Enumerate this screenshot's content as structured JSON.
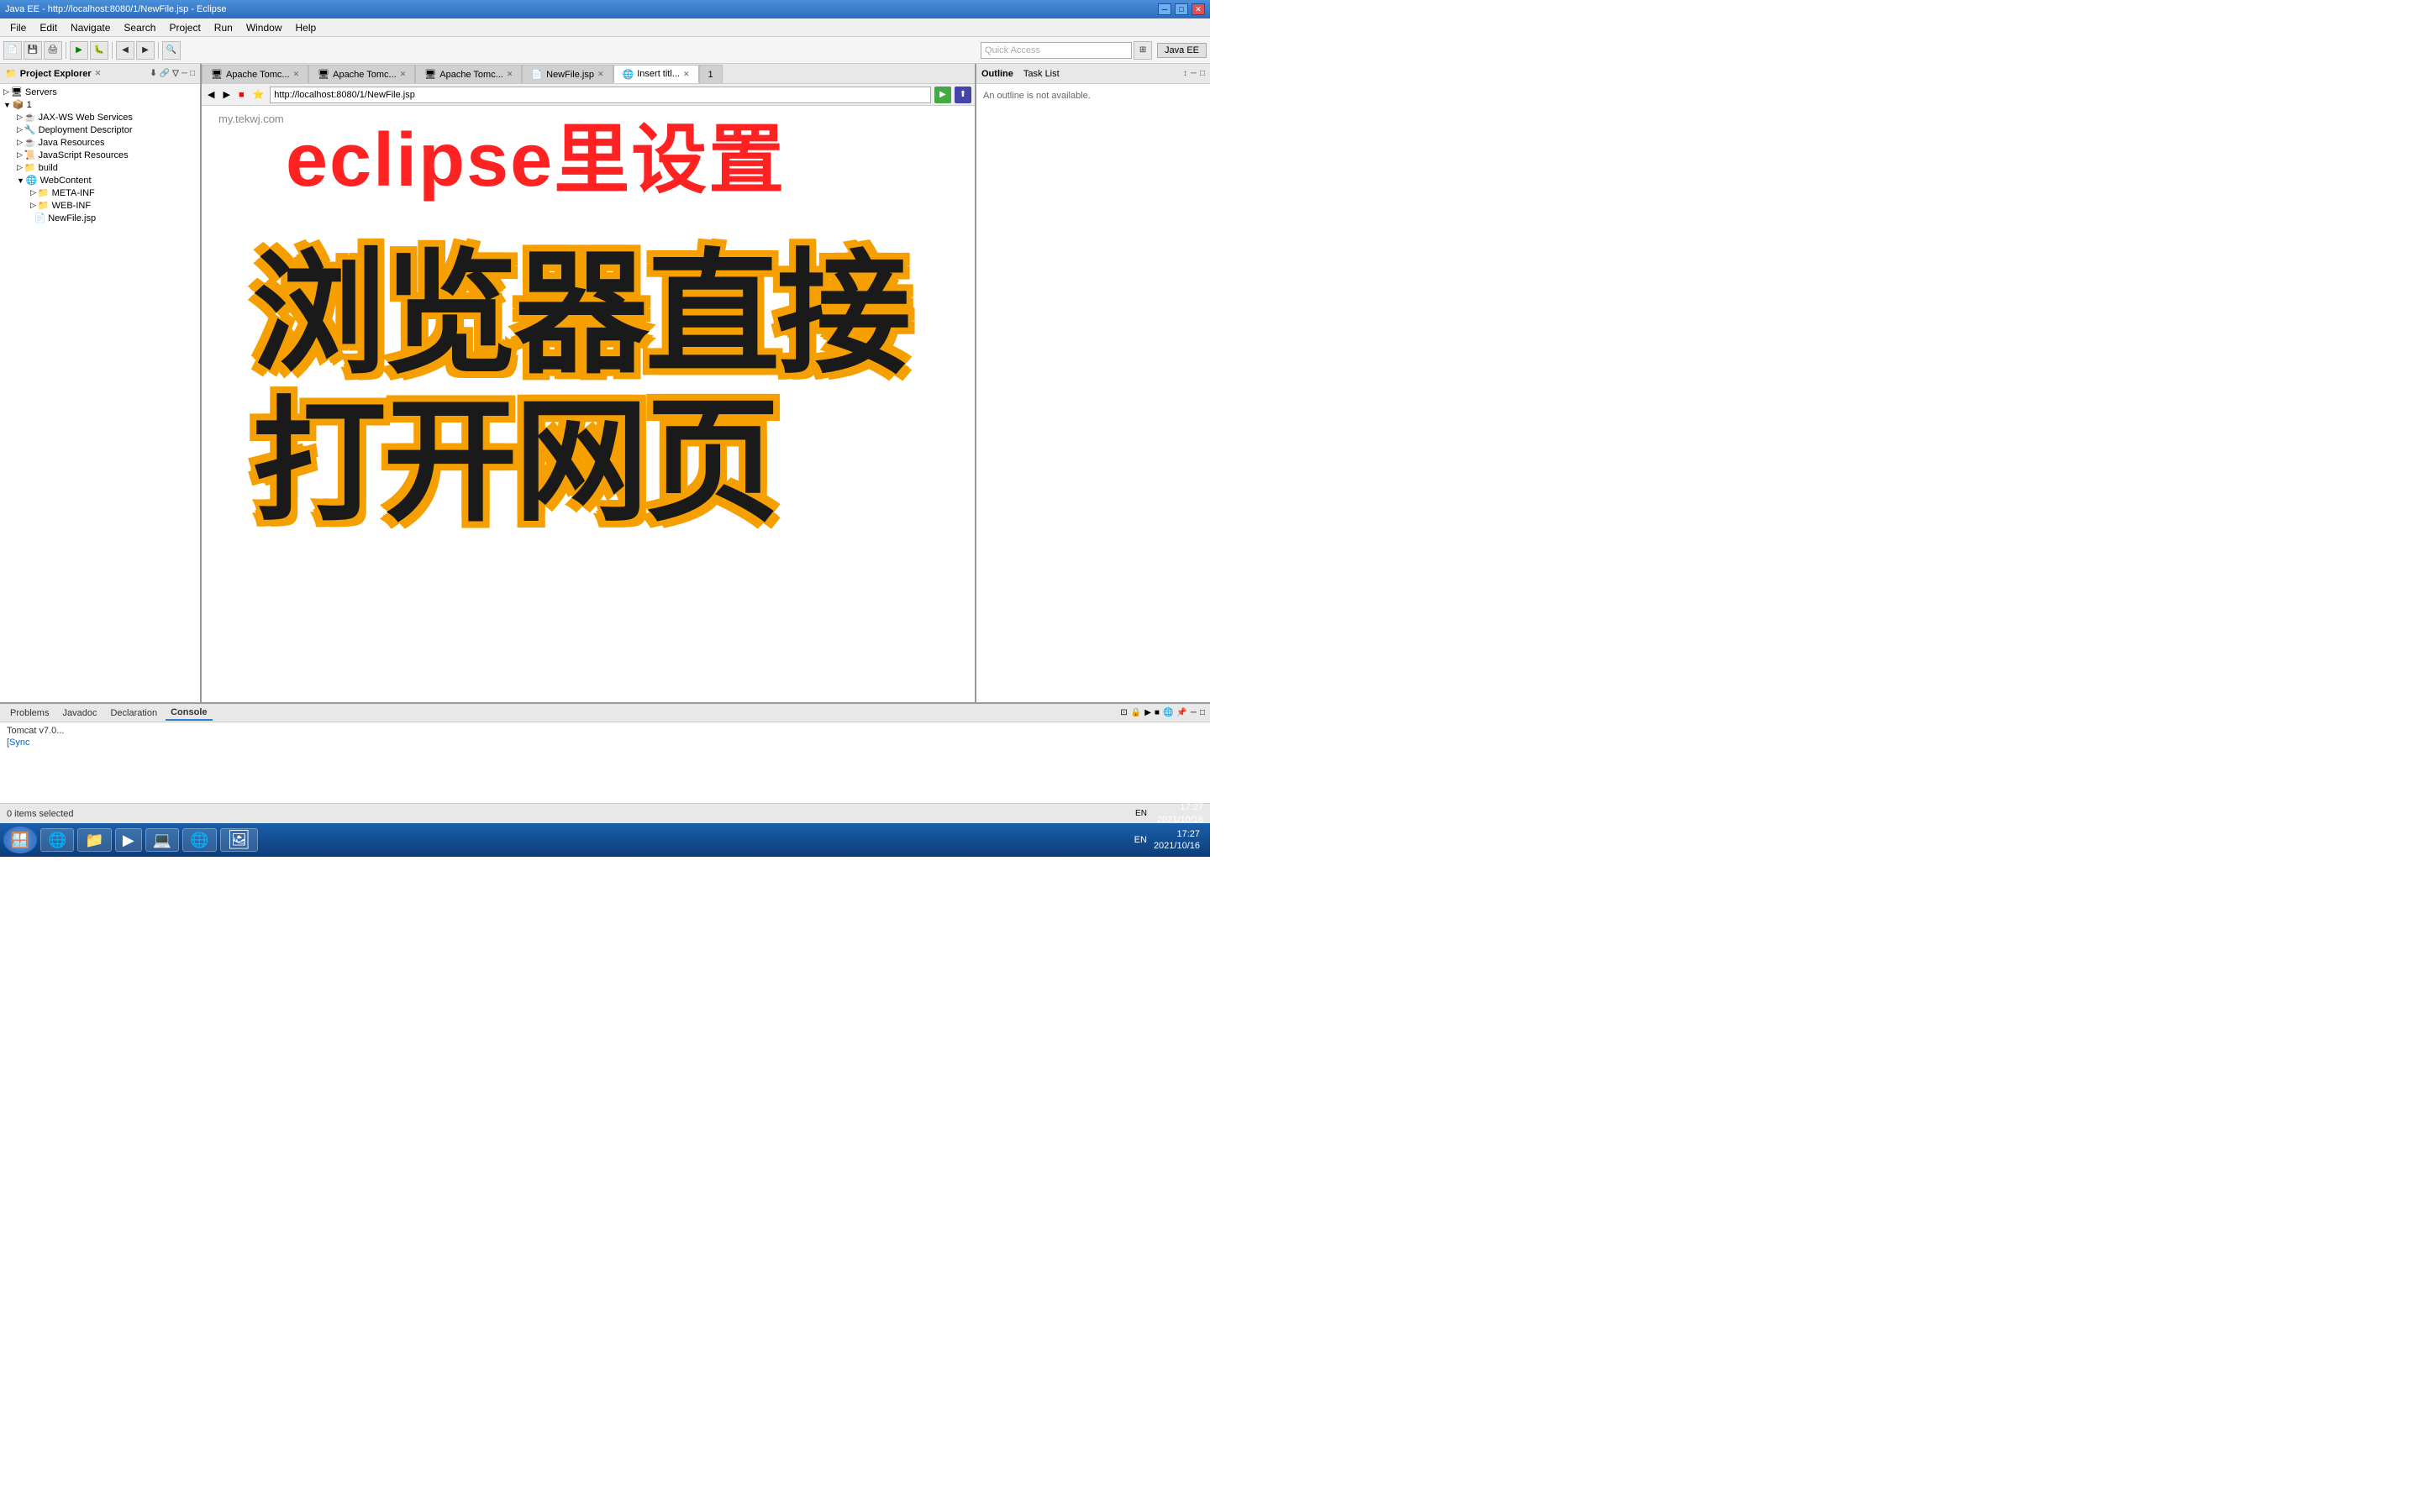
{
  "window": {
    "title": "Java EE - http://localhost:8080/1/NewFile.jsp - Eclipse"
  },
  "title_controls": {
    "minimize": "─",
    "maximize": "□",
    "close": "✕"
  },
  "menu": {
    "items": [
      "File",
      "Edit",
      "Navigate",
      "Search",
      "Project",
      "Run",
      "Window",
      "Help"
    ]
  },
  "toolbar": {
    "quick_access_placeholder": "Quick Access",
    "perspective": "Java EE"
  },
  "left_panel": {
    "title": "Project Explorer",
    "close_icon": "✕",
    "tree": [
      {
        "indent": 0,
        "arrow": "▷",
        "icon": "📁",
        "label": "Servers"
      },
      {
        "indent": 0,
        "arrow": "▼",
        "icon": "📁",
        "label": "1"
      },
      {
        "indent": 1,
        "arrow": "▷",
        "icon": "☕",
        "label": "JAX-WS Web Services"
      },
      {
        "indent": 1,
        "arrow": "▷",
        "icon": "🔧",
        "label": "Deployment Descriptor"
      },
      {
        "indent": 1,
        "arrow": "▷",
        "icon": "☕",
        "label": "Java Resources"
      },
      {
        "indent": 1,
        "arrow": "▷",
        "icon": "☕",
        "label": "JavaScript Resources"
      },
      {
        "indent": 1,
        "arrow": "▷",
        "icon": "📁",
        "label": "build"
      },
      {
        "indent": 1,
        "arrow": "▼",
        "icon": "🌐",
        "label": "WebContent"
      },
      {
        "indent": 2,
        "arrow": "▷",
        "icon": "📁",
        "label": "META-INF"
      },
      {
        "indent": 2,
        "arrow": "▷",
        "icon": "📁",
        "label": "WEB-INF"
      },
      {
        "indent": 2,
        "arrow": " ",
        "icon": "📄",
        "label": "NewFile.jsp"
      }
    ]
  },
  "editor_tabs": [
    {
      "label": "Apache Tomc...",
      "active": false
    },
    {
      "label": "Apache Tomc...",
      "active": false
    },
    {
      "label": "Apache Tomc...",
      "active": false
    },
    {
      "label": "NewFile.jsp",
      "active": false
    },
    {
      "label": "Insert titl...",
      "active": true
    },
    {
      "label": "1",
      "active": false
    }
  ],
  "address_bar": {
    "url": "http://localhost:8080/1/NewFile.jsp"
  },
  "website_text": "my.tekwj.com",
  "overlay": {
    "title_chinese": "eclipse里设置",
    "main_line1": "浏览器直接",
    "main_line2": "打开网页"
  },
  "right_panel": {
    "tabs": [
      "Outline",
      "Task List"
    ],
    "content": "An outline is not available."
  },
  "bottom_panel": {
    "tabs": [
      "Problems",
      "Javadoc",
      "Declaration",
      "Console"
    ],
    "active_tab": "Console",
    "console_lines": [
      {
        "text": "Tomcat v7.0...",
        "style": "normal"
      },
      {
        "text": "[Sync",
        "style": "blue"
      }
    ]
  },
  "status_bar": {
    "left": "0 items selected",
    "right_lang": "EN",
    "right_time": "17:27",
    "right_date": "2021/10/16"
  },
  "taskbar": {
    "items": [
      "🪟",
      "🌐",
      "📁",
      "▶",
      "💻",
      "🌐",
      "🖼"
    ]
  }
}
